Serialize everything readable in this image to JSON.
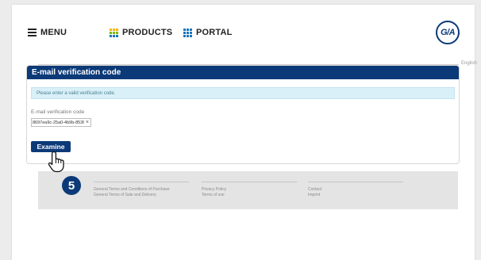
{
  "nav": {
    "menu_label": "MENU",
    "products_label": "PRODUCTS",
    "portal_label": "PORTAL"
  },
  "logo": {
    "text": "G/A"
  },
  "language": "English",
  "verification": {
    "title": "E-mail verification code",
    "alert": "Please enter a valid verification code.",
    "field_label": "E-mail verification code",
    "field_value": "8697ea9c-25a0-4b9b-8536-3f",
    "clear_symbol": "×",
    "submit_label": "Examine"
  },
  "step": {
    "number": "5"
  },
  "footer": {
    "col1": [
      "General Terms and Conditions of Purchase",
      "General Terms of Sale and Delivery"
    ],
    "col2": [
      "Privacy Policy",
      "Terms of use"
    ],
    "col3": [
      "Contact",
      "Imprint"
    ]
  },
  "colors": {
    "brand": "#0c3a78",
    "alert_bg": "#d9f0f8",
    "grid_icon": [
      "#f5b400",
      "#7ab800",
      "#1b75bc"
    ]
  },
  "icons": {
    "menu": "hamburger-icon",
    "products": "grid-icon",
    "portal": "grid-icon",
    "cursor": "pointer-hand-icon"
  }
}
